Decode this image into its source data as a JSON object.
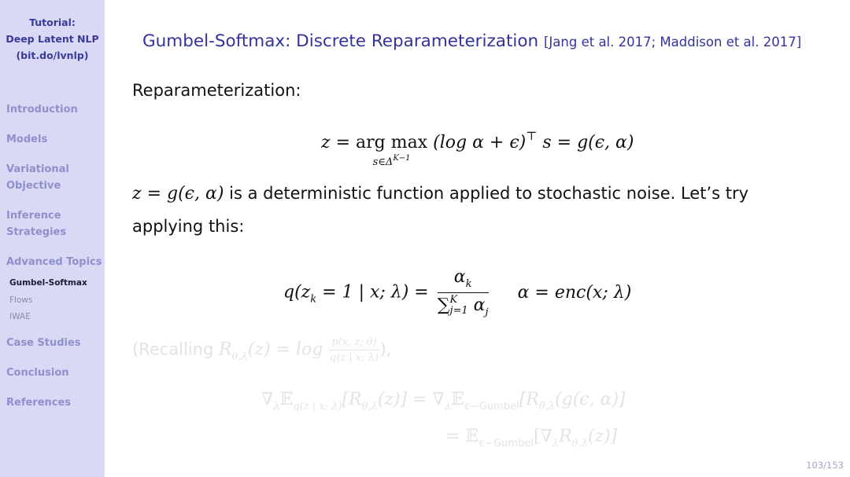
{
  "sidebar": {
    "title_lines": [
      "Tutorial:",
      "Deep Latent NLP",
      "(bit.do/lvnlp)"
    ],
    "sections": [
      {
        "label": "Introduction"
      },
      {
        "label": "Models"
      },
      {
        "label_lines": [
          "Variational",
          "Objective"
        ]
      },
      {
        "label_lines": [
          "Inference",
          "Strategies"
        ]
      },
      {
        "label": "Advanced Topics",
        "subsections": [
          {
            "label": "Gumbel-Softmax",
            "active": true
          },
          {
            "label": "Flows",
            "active": false
          },
          {
            "label": "IWAE",
            "active": false
          }
        ]
      },
      {
        "label": "Case Studies"
      },
      {
        "label": "Conclusion"
      },
      {
        "label": "References"
      }
    ]
  },
  "slide": {
    "title": "Gumbel-Softmax: Discrete Reparameterization",
    "citation": "[Jang et al. 2017; Maddison et al. 2017]",
    "heading": "Reparameterization:",
    "eq1": {
      "lhs": "z =",
      "op": "arg max",
      "op_sub": "s∈Δ",
      "op_sub_sup": "K−1",
      "body": "(log α + ϵ)",
      "transpose": "⊤",
      "rhs": "s = g(ϵ, α)"
    },
    "para1_math": "z = g(ϵ, α)",
    "para1_text": " is a deterministic function applied to stochastic noise. Let’s try",
    "para2_text": "applying this:",
    "eq2": {
      "lhs": "q(z",
      "lhs_sub": "k",
      "lhs_rest": " = 1 | x; λ) =",
      "num": "α",
      "num_sub": "k",
      "den": "∑",
      "den_sup": "K",
      "den_sub": "j=1",
      "den_var": " α",
      "den_var_sub": "j",
      "side": "α = enc(x; λ)"
    },
    "recall": {
      "prefix": "(Recalling ",
      "R": "R",
      "R_sub": "θ,λ",
      "mid": "(z) = log ",
      "num": "p(x, z; θ)",
      "den": "q(z | x; λ)",
      "suffix": "),"
    },
    "eq3": {
      "line1_lhs": "∇",
      "line1_lhs_sub": "λ",
      "E": "𝔼",
      "E_sub1": "q(z | x; λ)",
      "bracket1": "[R",
      "R_sub": "θ,λ",
      "bracket1_end": "(z)] = ∇",
      "E_sub2": "ϵ∼Gumbel",
      "bracket2": "[R",
      "bracket2_end": "(g(ϵ, α)]",
      "line2_prefix": "= 𝔼",
      "line2_bracket": "[∇",
      "line2_end": "(z)]"
    },
    "page": "103/153"
  }
}
